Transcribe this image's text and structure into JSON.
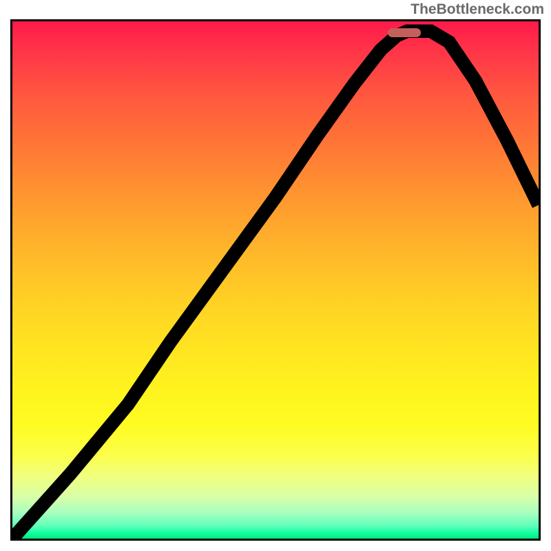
{
  "watermark": "TheBottleneck.com",
  "chart_data": {
    "type": "line",
    "title": "",
    "xlabel": "",
    "ylabel": "",
    "series": [
      {
        "name": "curve",
        "points_pct": [
          [
            0,
            0
          ],
          [
            11,
            12.5
          ],
          [
            22,
            26
          ],
          [
            30,
            38
          ],
          [
            40,
            52
          ],
          [
            50,
            66
          ],
          [
            58,
            78
          ],
          [
            65,
            88
          ],
          [
            70,
            94.5
          ],
          [
            73,
            97.2
          ],
          [
            75,
            98.1
          ],
          [
            79.5,
            98.1
          ],
          [
            83,
            96
          ],
          [
            88,
            88.5
          ],
          [
            94,
            77
          ],
          [
            100,
            64.5
          ]
        ]
      }
    ],
    "marker": {
      "x_pct": 74.5,
      "y_pct": 97.9,
      "width_pct": 6.2
    },
    "xlim": [
      0,
      100
    ],
    "ylim": [
      0,
      100
    ]
  }
}
